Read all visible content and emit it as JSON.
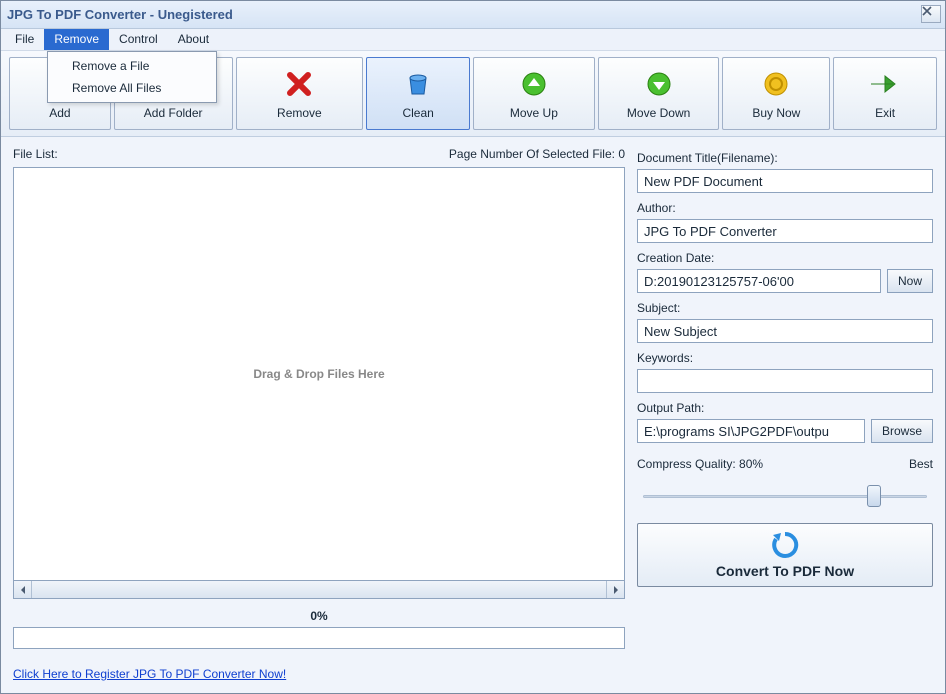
{
  "window": {
    "title": "JPG To PDF Converter - Unegistered"
  },
  "menu": {
    "file": "File",
    "remove": "Remove",
    "control": "Control",
    "about": "About",
    "dropdown": {
      "remove_file": "Remove a File",
      "remove_all": "Remove All Files"
    }
  },
  "toolbar": {
    "add": "Add",
    "add_folder": "Add Folder",
    "remove": "Remove",
    "clean": "Clean",
    "move_up": "Move Up",
    "move_down": "Move Down",
    "buy_now": "Buy Now",
    "exit": "Exit"
  },
  "left": {
    "file_list_label": "File List:",
    "page_number_label": "Page Number Of Selected File: 0",
    "drop_hint": "Drag & Drop Files Here",
    "progress": "0%",
    "register_link": "Click Here to Register JPG To PDF Converter Now!"
  },
  "form": {
    "doc_title_label": "Document Title(Filename):",
    "doc_title_value": "New PDF Document",
    "author_label": "Author:",
    "author_value": "JPG To PDF Converter",
    "creation_date_label": "Creation Date:",
    "creation_date_value": "D:20190123125757-06'00",
    "now_button": "Now",
    "subject_label": "Subject:",
    "subject_value": "New Subject",
    "keywords_label": "Keywords:",
    "keywords_value": "",
    "output_path_label": "Output Path:",
    "output_path_value": "E:\\programs SI\\JPG2PDF\\outpu",
    "browse_button": "Browse",
    "compress_label": "Compress Quality: 80%",
    "compress_best": "Best",
    "slider_pct": 80,
    "convert_label": "Convert To PDF Now"
  }
}
